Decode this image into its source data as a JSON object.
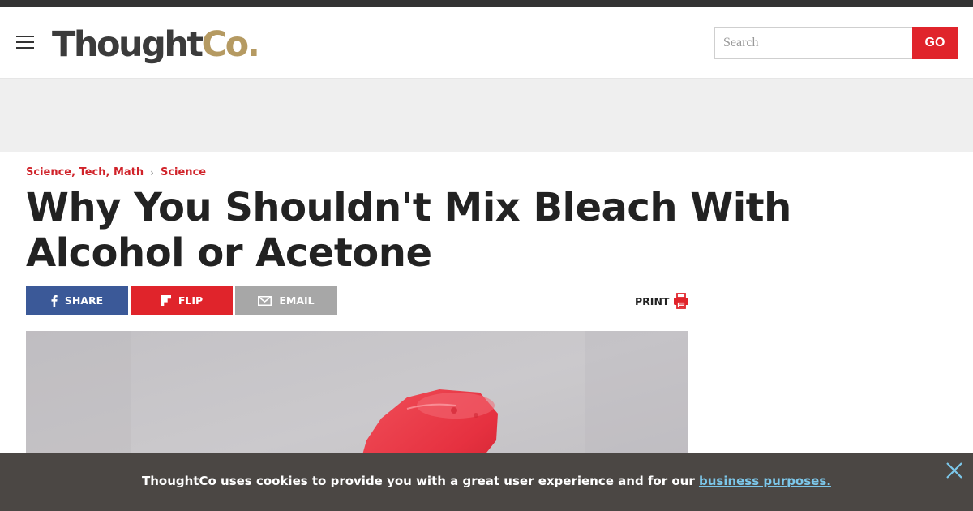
{
  "header": {
    "logo_main": "Thought",
    "logo_accent": "Co.",
    "search_placeholder": "Search",
    "search_button_label": "GO"
  },
  "breadcrumb": {
    "items": [
      "Science, Tech, Math",
      "Science"
    ],
    "separator": "›"
  },
  "article": {
    "title": "Why You Shouldn't Mix Bleach With Alcohol or Acetone"
  },
  "share": {
    "share_label": "SHARE",
    "flip_label": "FLIP",
    "email_label": "EMAIL",
    "print_label": "PRINT"
  },
  "cookie": {
    "text": "ThoughtCo uses cookies to provide you with a great user experience and for our",
    "link_text": "business purposes."
  },
  "colors": {
    "brand_red": "#e0242b",
    "logo_gold": "#b59a62",
    "facebook_blue": "#3b5998",
    "email_gray": "#a7a7a7",
    "cookie_bg": "#4b4744",
    "cookie_link": "#7cc7ea"
  },
  "icons": [
    "menu-icon",
    "facebook-icon",
    "flipboard-icon",
    "envelope-icon",
    "printer-icon",
    "close-icon"
  ]
}
